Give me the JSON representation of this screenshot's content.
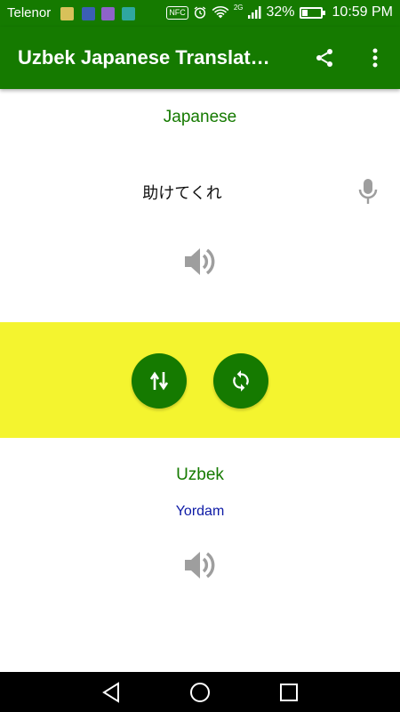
{
  "status_bar": {
    "carrier": "Telenor",
    "network": "2G",
    "battery_percent": "32%",
    "battery_level": 0.32,
    "time": "10:59 PM",
    "nfc": "NFC"
  },
  "app_bar": {
    "title": "Uzbek Japanese Translat…",
    "share_icon": "share-icon",
    "more_icon": "more-vert-icon"
  },
  "source": {
    "language": "Japanese",
    "text": "助けてくれ"
  },
  "actions": {
    "swap_icon": "swap-vertical-icon",
    "refresh_icon": "sync-icon"
  },
  "target": {
    "language": "Uzbek",
    "text": "Yordam"
  },
  "colors": {
    "primary": "#157a00",
    "band": "#f4f42f",
    "result_text": "#0d1aa6",
    "icon_gray": "#9e9e9e"
  }
}
